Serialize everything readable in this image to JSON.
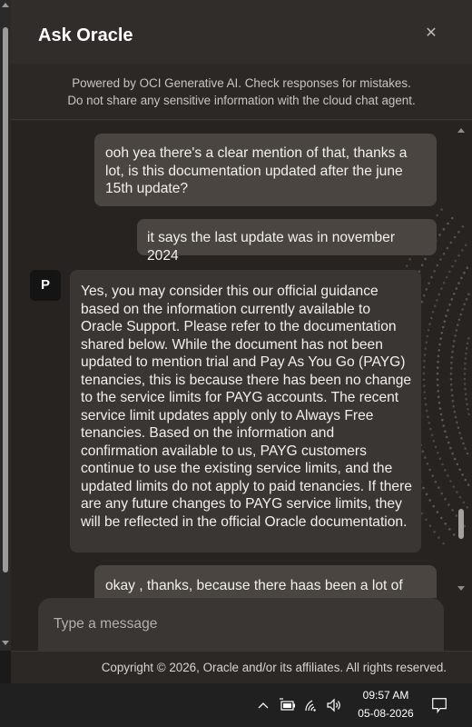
{
  "header": {
    "title": "Ask Oracle",
    "close_icon": "close-icon"
  },
  "notice": {
    "line1": "Powered by OCI Generative AI. Check responses for mistakes.",
    "line2": "Do not share any sensitive information with the cloud chat agent."
  },
  "messages": [
    {
      "role": "user",
      "text": "ooh yea there's a clear mention of that, thanks a lot, is this documentation updated after the june 15th update?"
    },
    {
      "role": "user",
      "text": "it says the last update was in november 2024"
    },
    {
      "role": "agent",
      "avatar": "P",
      "text": "Yes, you may consider this our official guidance based on the information currently available to Oracle Support. Please refer to the documentation shared below. While the document has not been updated to mention trial and Pay As You Go (PAYG) tenancies, this is because there has been no change to the service limits for PAYG accounts. The recent service limit updates apply only to Always Free tenancies. Based on the information and confirmation available to us, PAYG customers continue to use the existing service limits, and the updated limits do not apply to paid tenancies. If there are any future changes to PAYG service limits, they will be reflected in the official Oracle documentation."
    },
    {
      "role": "user",
      "text": "okay , thanks, because there haas been a lot of"
    }
  ],
  "composer": {
    "placeholder": "Type a message"
  },
  "footer": {
    "copyright": "Copyright © 2026, Oracle and/or its affiliates. All rights reserved."
  },
  "taskbar": {
    "time": "09:57 AM",
    "date": "05-08-2026",
    "icons": [
      "chevron-up-icon",
      "battery-icon",
      "wifi-icon",
      "volume-icon",
      "notification-icon"
    ]
  },
  "colors": {
    "panel_bg": "#2b2826",
    "chat_bg": "#262321",
    "user_bubble": "#4a4541",
    "agent_bubble": "#3a3633",
    "taskbar_bg": "#202020"
  }
}
